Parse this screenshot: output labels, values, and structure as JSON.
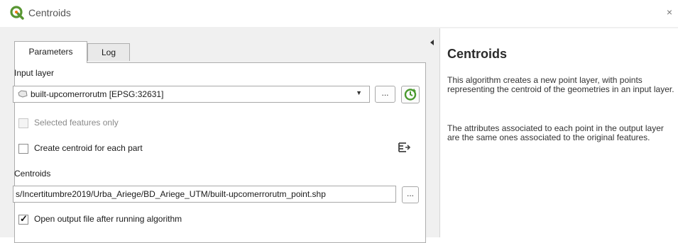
{
  "window": {
    "title": "Centroids",
    "close_glyph": "×"
  },
  "tabs": [
    {
      "label": "Parameters",
      "active": true
    },
    {
      "label": "Log",
      "active": false
    }
  ],
  "form": {
    "input_layer_label": "Input layer",
    "input_layer_value": "built-upcomerrorutm [EPSG:32631]",
    "browse_label": "...",
    "selected_features_label": "Selected features only",
    "selected_features_checked": false,
    "selected_features_enabled": false,
    "create_centroid_label": "Create centroid for each part",
    "create_centroid_checked": false,
    "centroids_label": "Centroids",
    "centroids_path": "s/Incertitumbre2019/Urba_Ariege/BD_Ariege_UTM/built-upcomerrorutm_point.shp",
    "output_browse_label": "...",
    "open_output_label": "Open output file after running algorithm",
    "open_output_checked": true,
    "check_glyph": "✓"
  },
  "icons": {
    "logo": "qgis-logo",
    "polygon_layer": "polygon-layer-icon",
    "refresh": "iterate-refresh-icon",
    "expression": "data-defined-override-icon",
    "dropdown": "chevron-down-icon",
    "splitter": "collapse-left-icon"
  },
  "help": {
    "title": "Centroids",
    "paragraph1": "This algorithm creates a new point layer, with points representing the centroid of the geometries in an input layer.",
    "paragraph2": "The attributes associated to each point in the output layer are the same ones associated to the original features."
  },
  "colors": {
    "qgis_green": "#589632",
    "qgis_yellow": "#ee7913"
  }
}
